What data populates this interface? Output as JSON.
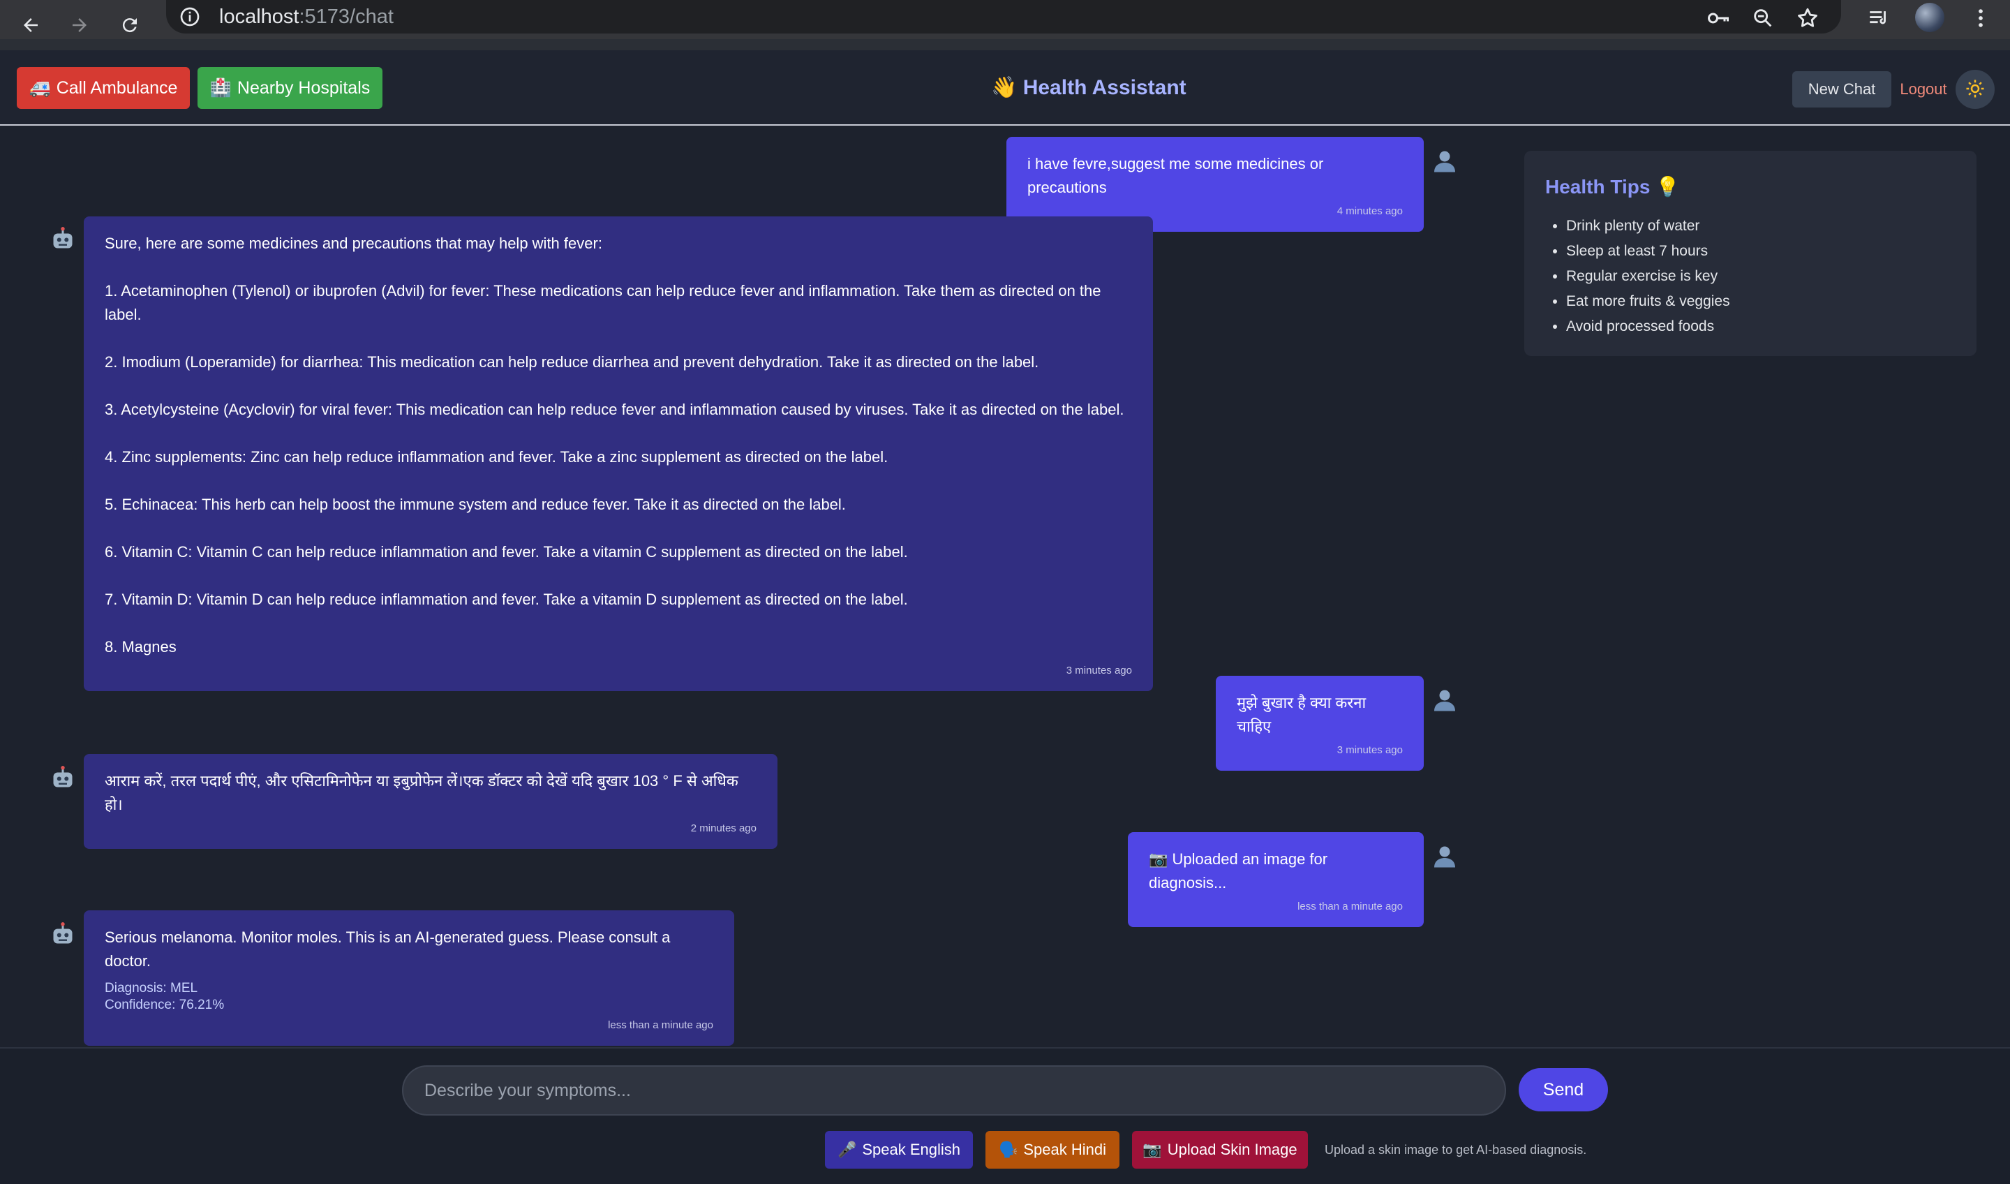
{
  "browser": {
    "url_host": "localhost",
    "url_path": ":5173/chat"
  },
  "header": {
    "ambulance_label": "Call Ambulance",
    "hospitals_label": "Nearby Hospitals",
    "title": "Health Assistant",
    "new_chat_label": "New Chat",
    "logout_label": "Logout"
  },
  "messages": [
    {
      "role": "user",
      "text": "i have fevre,suggest me some medicines or precautions",
      "time": "4 minutes ago"
    },
    {
      "role": "bot",
      "text": "Sure, here are some medicines and precautions that may help with fever:\n\n1. Acetaminophen (Tylenol) or ibuprofen (Advil) for fever: These medications can help reduce fever and inflammation. Take them as directed on the label.\n\n2. Imodium (Loperamide) for diarrhea: This medication can help reduce diarrhea and prevent dehydration. Take it as directed on the label.\n\n3. Acetylcysteine (Acyclovir) for viral fever: This medication can help reduce fever and inflammation caused by viruses. Take it as directed on the label.\n\n4. Zinc supplements: Zinc can help reduce inflammation and fever. Take a zinc supplement as directed on the label.\n\n5. Echinacea: This herb can help boost the immune system and reduce fever. Take it as directed on the label.\n\n6. Vitamin C: Vitamin C can help reduce inflammation and fever. Take a vitamin C supplement as directed on the label.\n\n7. Vitamin D: Vitamin D can help reduce inflammation and fever. Take a vitamin D supplement as directed on the label.\n\n8. Magnes",
      "time": "3 minutes ago"
    },
    {
      "role": "user",
      "text": "मुझे बुखार है क्या करना चाहिए",
      "time": "3 minutes ago"
    },
    {
      "role": "bot",
      "text": "आराम करें, तरल पदार्थ पीएं, और एसिटामिनोफेन या इबुप्रोफेन लें।एक डॉक्टर को देखें यदि बुखार 103 ° F से अधिक हो।",
      "time": "2 minutes ago"
    },
    {
      "role": "user",
      "text": "Uploaded an image for diagnosis...",
      "time": "less than a minute ago"
    },
    {
      "role": "bot",
      "text": "Serious melanoma. Monitor moles. This is an AI-generated guess. Please consult a doctor.",
      "diagnosis": "Diagnosis: MEL",
      "confidence": "Confidence: 76.21%",
      "time": "less than a minute ago"
    }
  ],
  "tips": {
    "title": "Health Tips",
    "items": [
      "Drink plenty of water",
      "Sleep at least 7 hours",
      "Regular exercise is key",
      "Eat more fruits & veggies",
      "Avoid processed foods"
    ]
  },
  "input": {
    "placeholder": "Describe your symptoms...",
    "send_label": "Send",
    "speak_english_label": "Speak English",
    "speak_hindi_label": "Speak Hindi",
    "upload_label": "Upload Skin Image",
    "upload_hint": "Upload a skin image to get AI-based diagnosis."
  },
  "colors": {
    "user_bubble": "#5046e5",
    "bot_bubble": "#312e81",
    "ambulance": "#d63a32",
    "hospitals": "#3aa54b",
    "send": "#4f46e5"
  }
}
